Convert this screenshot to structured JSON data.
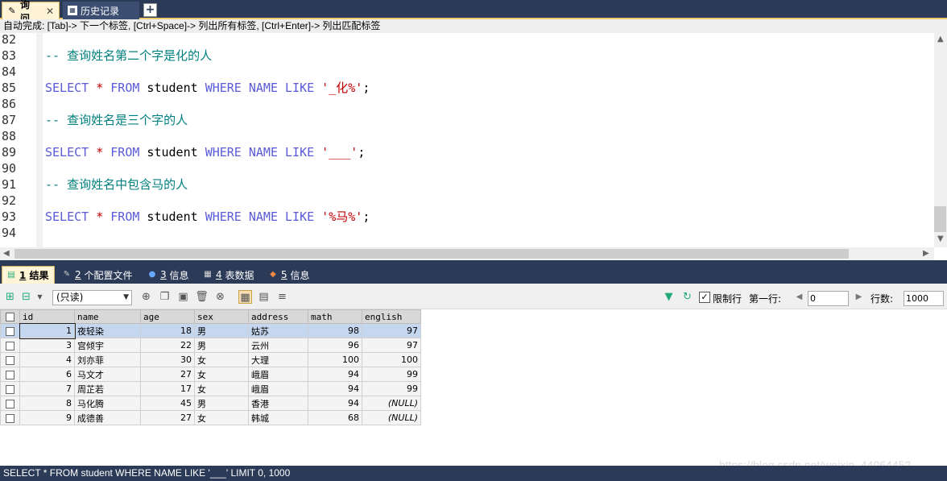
{
  "tabs": [
    {
      "label": "询问",
      "active": true,
      "icon": "query-icon"
    },
    {
      "label": "历史记录",
      "active": false,
      "icon": "history-icon"
    }
  ],
  "new_tab_label": "+",
  "autocomplete_hint": "自动完成: [Tab]-> 下一个标签, [Ctrl+Space]-> 列出所有标签, [Ctrl+Enter]-> 列出匹配标签",
  "editor": {
    "lines": [
      {
        "n": "82",
        "parts": []
      },
      {
        "n": "83",
        "parts": [
          {
            "t": "-- 查询姓名第二个字是化的人",
            "c": "cm"
          }
        ]
      },
      {
        "n": "84",
        "parts": []
      },
      {
        "n": "85",
        "parts": [
          {
            "t": "SELECT",
            "c": "kw"
          },
          {
            "t": " * ",
            "c": "str"
          },
          {
            "t": "FROM",
            "c": "kw"
          },
          {
            "t": " student ",
            "c": ""
          },
          {
            "t": "WHERE",
            "c": "kw"
          },
          {
            "t": " NAME ",
            "c": "kw"
          },
          {
            "t": "LIKE",
            "c": "kw"
          },
          {
            "t": " '_化%'",
            "c": "str"
          },
          {
            "t": ";",
            "c": ""
          }
        ]
      },
      {
        "n": "86",
        "parts": []
      },
      {
        "n": "87",
        "parts": [
          {
            "t": "-- 查询姓名是三个字的人",
            "c": "cm"
          }
        ]
      },
      {
        "n": "88",
        "parts": []
      },
      {
        "n": "89",
        "parts": [
          {
            "t": "SELECT",
            "c": "kw"
          },
          {
            "t": " * ",
            "c": "str"
          },
          {
            "t": "FROM",
            "c": "kw"
          },
          {
            "t": " student ",
            "c": ""
          },
          {
            "t": "WHERE",
            "c": "kw"
          },
          {
            "t": " NAME ",
            "c": "kw"
          },
          {
            "t": "LIKE",
            "c": "kw"
          },
          {
            "t": " '___'",
            "c": "str"
          },
          {
            "t": ";",
            "c": ""
          }
        ]
      },
      {
        "n": "90",
        "parts": []
      },
      {
        "n": "91",
        "parts": [
          {
            "t": "-- 查询姓名中包含马的人",
            "c": "cm"
          }
        ]
      },
      {
        "n": "92",
        "parts": []
      },
      {
        "n": "93",
        "parts": [
          {
            "t": "SELECT",
            "c": "kw"
          },
          {
            "t": " * ",
            "c": "str"
          },
          {
            "t": "FROM",
            "c": "kw"
          },
          {
            "t": " student ",
            "c": ""
          },
          {
            "t": "WHERE",
            "c": "kw"
          },
          {
            "t": " NAME ",
            "c": "kw"
          },
          {
            "t": "LIKE",
            "c": "kw"
          },
          {
            "t": " '%马%'",
            "c": "str"
          },
          {
            "t": ";",
            "c": ""
          }
        ]
      },
      {
        "n": "94",
        "parts": []
      }
    ]
  },
  "result_tabs": [
    {
      "num": "1",
      "label": "结果",
      "active": true,
      "icon": "result-grid-icon"
    },
    {
      "num": "2",
      "label": "个配置文件",
      "active": false,
      "icon": "profile-icon"
    },
    {
      "num": "3",
      "label": "信息",
      "active": false,
      "icon": "info-icon"
    },
    {
      "num": "4",
      "label": "表数据",
      "active": false,
      "icon": "table-data-icon"
    },
    {
      "num": "5",
      "label": "信息",
      "active": false,
      "icon": "info-multi-icon"
    }
  ],
  "toolbar": {
    "mode_select": "(只读)",
    "limit_rows_label": "限制行",
    "first_row_label": "第一行:",
    "first_row_value": "0",
    "row_count_label": "行数:",
    "row_count_value": "1000"
  },
  "grid": {
    "columns": [
      "id",
      "name",
      "age",
      "sex",
      "address",
      "math",
      "english"
    ],
    "rows": [
      [
        "1",
        "夜轻染",
        "18",
        "男",
        "姑苏",
        "98",
        "97"
      ],
      [
        "3",
        "宫倾宇",
        "22",
        "男",
        "云州",
        "96",
        "97"
      ],
      [
        "4",
        "刘亦菲",
        "30",
        "女",
        "大理",
        "100",
        "100"
      ],
      [
        "6",
        "马文才",
        "27",
        "女",
        "峨眉",
        "94",
        "99"
      ],
      [
        "7",
        "周芷若",
        "17",
        "女",
        "峨眉",
        "94",
        "99"
      ],
      [
        "8",
        "马化腾",
        "45",
        "男",
        "香港",
        "94",
        "(NULL)"
      ],
      [
        "9",
        "成德善",
        "27",
        "女",
        "韩城",
        "68",
        "(NULL)"
      ]
    ]
  },
  "status_text": "SELECT * FROM student WHERE NAME LIKE '___' LIMIT 0, 1000",
  "watermark": "https://blog.csdn.net/weixin_44064452",
  "colors": {
    "frame": "#2b3a57",
    "keyword": "#5a5ad8",
    "comment": "#008080",
    "string": "#c00000",
    "selected_row": "#c5d7ef"
  }
}
